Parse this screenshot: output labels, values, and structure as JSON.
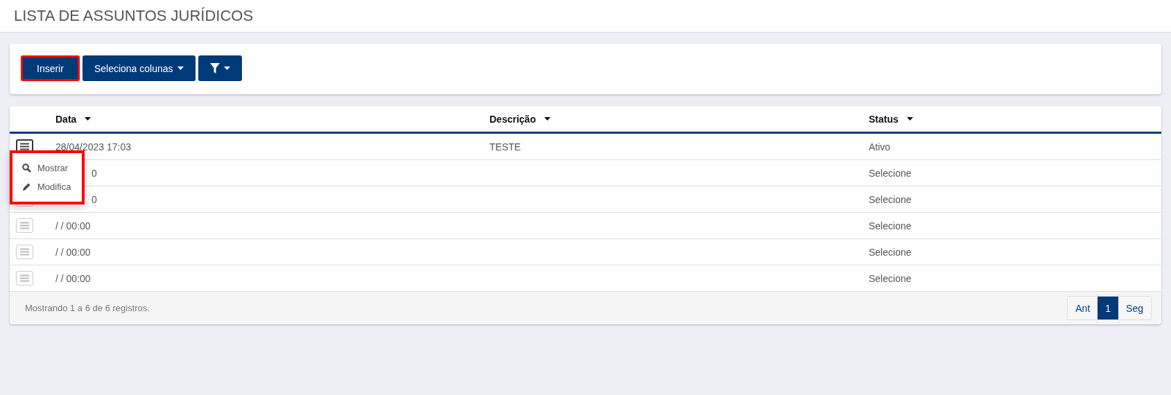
{
  "page": {
    "title": "LISTA DE ASSUNTOS JURÍDICOS"
  },
  "toolbar": {
    "buttons": [
      {
        "kind": "text",
        "label": "Inserir",
        "caret": false,
        "highlighted": true
      },
      {
        "kind": "text",
        "label": "Seleciona colunas",
        "caret": true,
        "highlighted": false
      },
      {
        "kind": "filter",
        "caret": true,
        "highlighted": false
      }
    ]
  },
  "table": {
    "columns": [
      {
        "label": "Data"
      },
      {
        "label": "Descrição"
      },
      {
        "label": "Status"
      }
    ],
    "rows": [
      {
        "cells": [
          "28/04/2023 17:03",
          "TESTE",
          "Ativo"
        ],
        "menu_open": true
      },
      {
        "cells": [
          "0",
          "",
          "Selecione"
        ],
        "menu_open": false
      },
      {
        "cells": [
          "0",
          "",
          "Selecione"
        ],
        "menu_open": false
      },
      {
        "cells": [
          "/ / 00:00",
          "",
          "Selecione"
        ],
        "menu_open": false
      },
      {
        "cells": [
          "/ / 00:00",
          "",
          "Selecione"
        ],
        "menu_open": false
      },
      {
        "cells": [
          "/ / 00:00",
          "",
          "Selecione"
        ],
        "menu_open": false
      }
    ],
    "row_menu": {
      "highlighted": true,
      "items": [
        {
          "kind": "search",
          "label": "Mostrar"
        },
        {
          "kind": "edit",
          "label": "Modifica"
        }
      ]
    },
    "footer": {
      "summary": "Mostrando 1 a 6 de 6 registros."
    },
    "pagination": [
      {
        "label": "Ant",
        "selected": false
      },
      {
        "label": "1",
        "selected": true
      },
      {
        "label": "Seg",
        "selected": false
      }
    ]
  }
}
